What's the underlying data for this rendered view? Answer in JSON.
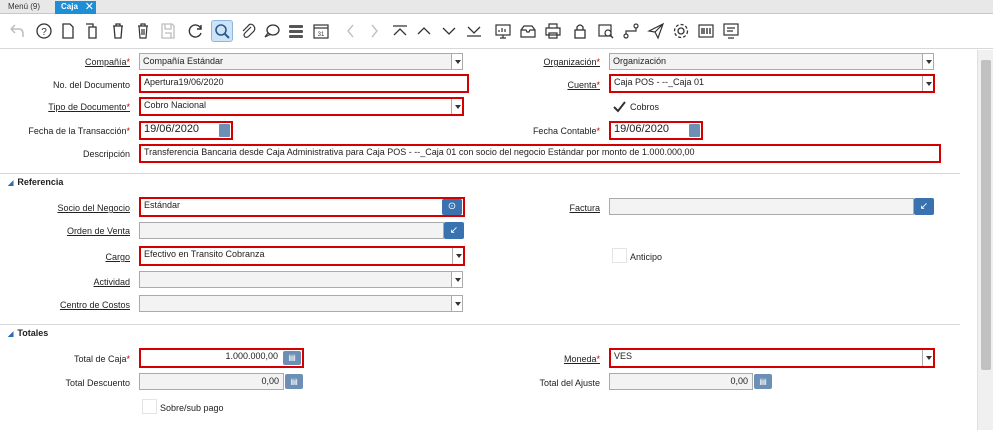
{
  "tabs": {
    "menu": "Menú (9)",
    "active": "Caja"
  },
  "toolbar": [
    "undo-icon",
    "help-icon",
    "new-record-icon",
    "copy-record-icon",
    "delete-icon",
    "delete-selection-icon",
    "save-icon",
    "refresh-icon",
    "find-icon",
    "attachment-icon",
    "chat-icon",
    "grid-toggle-icon",
    "calendar-icon",
    "previous-record-icon",
    "next-record-icon",
    "first-record-icon",
    "parent-record-icon",
    "detail-record-icon",
    "last-record-icon",
    "report-icon",
    "archive-icon",
    "print-icon",
    "lock-icon",
    "zoom-across-icon",
    "workflow-icon",
    "send-icon",
    "process-icon",
    "product-info-icon",
    "history-icon"
  ],
  "form": {
    "compania": {
      "label": "Compañía",
      "value": "Compañía Estándar"
    },
    "organizacion": {
      "label": "Organización",
      "value": "Organización"
    },
    "no_documento": {
      "label": "No. del Documento",
      "value": "Apertura19/06/2020"
    },
    "cuenta": {
      "label": "Cuenta",
      "value": "Caja POS - --_Caja 01"
    },
    "tipo_documento": {
      "label": "Tipo de Documento",
      "value": "Cobro Nacional"
    },
    "cobros": {
      "label": "Cobros",
      "checked": true
    },
    "fecha_transaccion": {
      "label": "Fecha de la Transacción",
      "value": "19/06/2020"
    },
    "fecha_contable": {
      "label": "Fecha Contable",
      "value": "19/06/2020"
    },
    "descripcion": {
      "label": "Descripción",
      "value": "Transferencia Bancaria desde Caja Administrativa para Caja POS - --_Caja 01 con socio del negocio Estándar por monto de 1.000.000,00"
    }
  },
  "referencia": {
    "title": "Referencia",
    "socio_negocio": {
      "label": "Socio del Negocio",
      "value": "Estándar"
    },
    "factura": {
      "label": "Factura",
      "value": ""
    },
    "orden_venta": {
      "label": "Orden de Venta",
      "value": ""
    },
    "cargo": {
      "label": "Cargo",
      "value": "Efectivo en Transito Cobranza"
    },
    "anticipo": {
      "label": "Anticipo",
      "checked": false
    },
    "actividad": {
      "label": "Actividad",
      "value": ""
    },
    "centro_costos": {
      "label": "Centro de Costos",
      "value": ""
    }
  },
  "totales": {
    "title": "Totales",
    "total_caja": {
      "label": "Total de Caja",
      "value": "1.000.000,00"
    },
    "moneda": {
      "label": "Moneda",
      "value": "VES"
    },
    "total_descuento": {
      "label": "Total Descuento",
      "value": "0,00"
    },
    "total_ajuste": {
      "label": "Total del Ajuste",
      "value": "0,00"
    },
    "sobre_sub_pago": {
      "label": "Sobre/sub pago",
      "checked": false
    }
  },
  "colors": {
    "accent": "#1e8fd6",
    "required_border": "#d40000",
    "button_blue": "#3a72b0"
  }
}
